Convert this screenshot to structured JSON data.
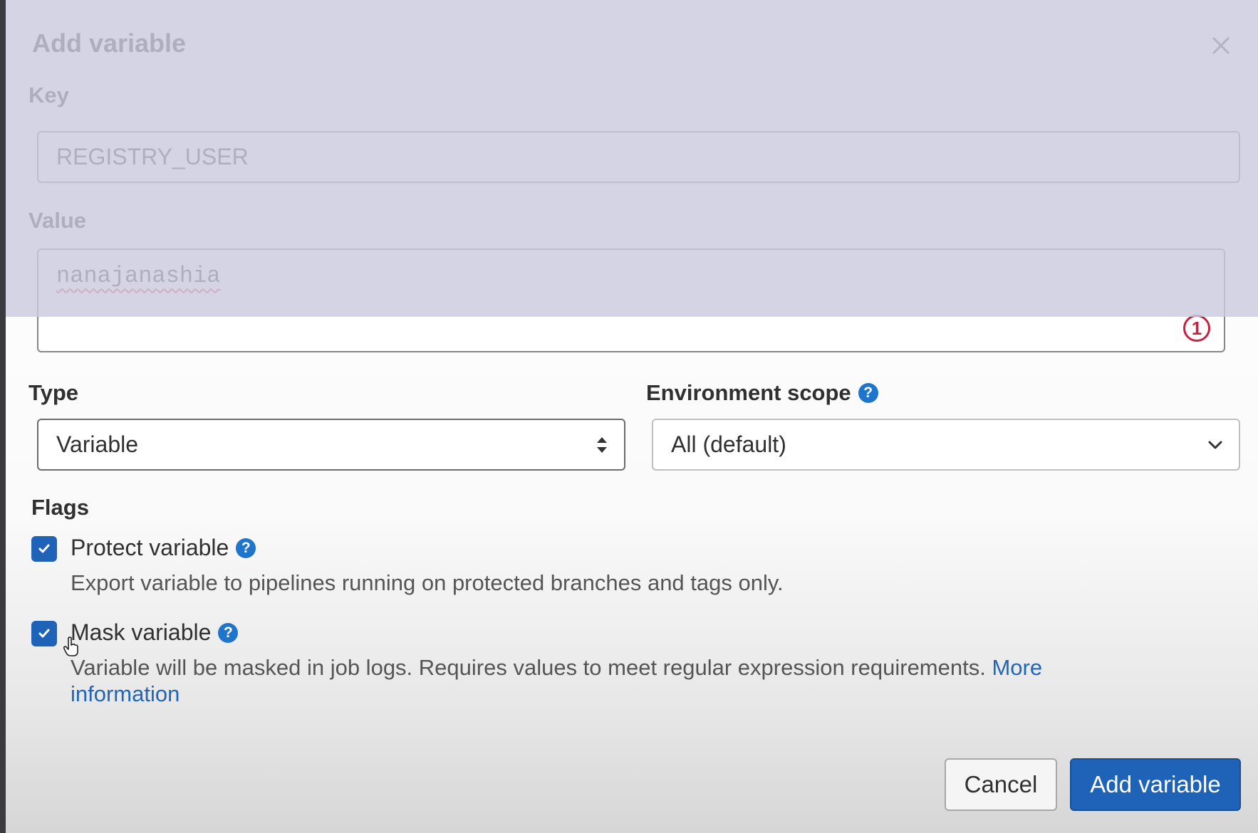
{
  "dialog": {
    "title": "Add variable",
    "close_icon": "close-icon"
  },
  "key": {
    "label": "Key",
    "value": "REGISTRY_USER"
  },
  "value_field": {
    "label": "Value",
    "value": "nanajanashia",
    "counter": "1"
  },
  "type": {
    "label": "Type",
    "selected": "Variable"
  },
  "environment_scope": {
    "label": "Environment scope",
    "selected": "All (default)"
  },
  "flags": {
    "heading": "Flags",
    "protect": {
      "label": "Protect variable",
      "checked": true,
      "description": "Export variable to pipelines running on protected branches and tags only."
    },
    "mask": {
      "label": "Mask variable",
      "checked": true,
      "description": "Variable will be masked in job logs. Requires values to meet regular expression requirements.",
      "link_text_1": "More",
      "link_text_2": "information"
    }
  },
  "actions": {
    "cancel": "Cancel",
    "submit": "Add variable"
  },
  "colors": {
    "primary": "#1f63b8",
    "help_icon": "#1f75cb",
    "counter_badge": "#c8203e",
    "link": "#1f66b9"
  }
}
